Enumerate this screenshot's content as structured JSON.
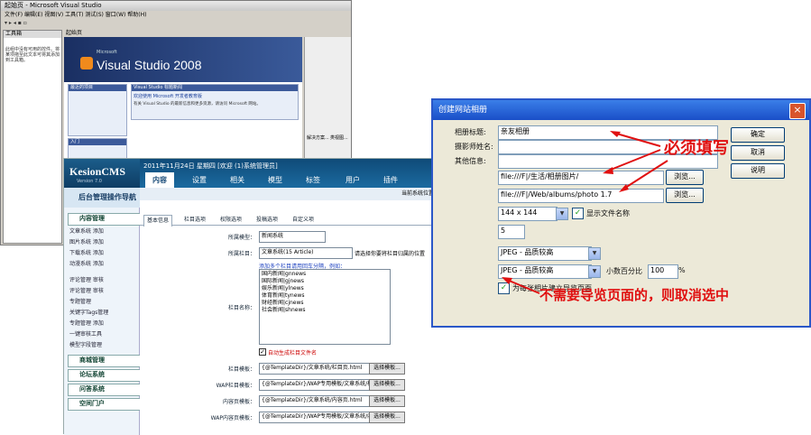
{
  "vs": {
    "title": "起始页 - Microsoft Visual Studio",
    "menu": "文件(F)  编辑(E)  视图(V)  工具(T)  测试(S)  窗口(W)  帮助(H)",
    "toolbar": "▾ ▸ ◂ ▪ ▫",
    "tab_label": "起始页",
    "left_panel_header": "工具箱",
    "left_panel_text": "此组中没有可用的控件。将某项拖至此文本可将其添加到工具箱。",
    "product_brand": "Microsoft",
    "product_name": "Visual Studio 2008",
    "recent_header": "最近的项目",
    "getting_started_header": "入门",
    "headlines_header": "Visual Studio 标题新闻",
    "news_title": "欢迎使用 Microsoft 开发者教育版",
    "news_body": "有关 Visual Studio 的最新信息和更多资源，请访问 Microsoft 网站。",
    "right_panel_links": [
      "解决方案...",
      "类视图..."
    ]
  },
  "cms": {
    "brand": "KesionCMS",
    "version": "Version 7.0",
    "user_info": "2011年11月24日  星期四 [欢迎 (1)系统管理员]",
    "tabs": [
      "内容",
      "设置",
      "相关",
      "模型",
      "标签",
      "用户",
      "插件"
    ],
    "sidebar_title": "后台管理操作导航",
    "sidebar_sections": [
      "内容管理",
      "商城管理",
      "论坛系统",
      "问答系统",
      "空间门户"
    ],
    "sidebar_items": [
      "文章系统 添加",
      "图片系统 添加",
      "下载系统 添加",
      "动漫系统 添加"
    ],
    "sidebar_links": [
      "评论管理 审核",
      "评论管理 审核",
      "专题管理",
      "关键字Tags管理",
      "专题管理 添加",
      "一键审核工具",
      "模型字段管理"
    ],
    "crumb": "当前系统位置",
    "subtabs": [
      "基本信息",
      "栏目选项",
      "权限选项",
      "投稿选项",
      "自定义项"
    ],
    "form": {
      "model_label": "所属模型：",
      "model_value": "新闻系统",
      "parent_label": "所属栏目：",
      "parent_value": "文章系统(15 Article)",
      "parent_note": "请选择你要将栏目归属的位置",
      "names_hint": "添加多个栏目请用回车分隔，例如：",
      "names_label": "栏目名称：",
      "names_list": [
        "国内新闻|gnnews",
        "国际新闻|gjnews",
        "娱乐新闻|ylnews",
        "体育新闻|tynews",
        "财经新闻|cjnews",
        "社会新闻|shnews"
      ],
      "auto_label": "自动生成栏目文件名",
      "row1_label": "栏目模板：",
      "row1_value": "{@TemplateDir}/文章系统/栏目页.html",
      "row2_label": "WAP栏目模板：",
      "row2_value": "{@TemplateDir}/WAP专用模板/文章系统/栏",
      "row3_label": "内容页模板：",
      "row3_value": "{@TemplateDir}/文章系统/内容页.html",
      "row4_label": "WAP内容页模板：",
      "row4_value": "{@TemplateDir}/WAP专用模板/文章系统/内",
      "pick_button": "选择模板..."
    }
  },
  "dialog": {
    "title": "创建网站相册",
    "close_icon": "×",
    "labels": {
      "title": "相册标题:",
      "photographer": "摄影师姓名:",
      "other_info": "其他信息:",
      "source": "源图像文件夹:",
      "dest": "目标文件夹:",
      "thumb_size": "缩略图大小:",
      "columns": "列:",
      "thumb_format": "缩略图格式:",
      "photo_format": "相片格式:",
      "scale": "小数位数:"
    },
    "values": {
      "title": "亲友相册",
      "photographer": "",
      "other_info": "",
      "source": "file:///F|/生活/相册图片/",
      "dest": "file:///F|/Web/albums/photo 1.7",
      "thumb_size": "144 x 144",
      "show_filename": "显示文件名称",
      "columns": "5",
      "thumb_format": "JPEG - 品质较高",
      "photo_format": "JPEG - 品质较高",
      "scale_label": "小数百分比",
      "scale": "100",
      "percent": "%",
      "nav_pages": "为每张相片建立导览页面"
    },
    "buttons": {
      "ok": "确定",
      "cancel": "取消",
      "help": "说明",
      "browse": "浏览..."
    },
    "annotation_required": "必须填写",
    "annotation_uncheck": "不需要导览页面的，则取消选中"
  },
  "colors": {
    "annotation": "#e01010",
    "dialog_title": "#1a4fc8",
    "cms_header": "#0f4a78"
  }
}
